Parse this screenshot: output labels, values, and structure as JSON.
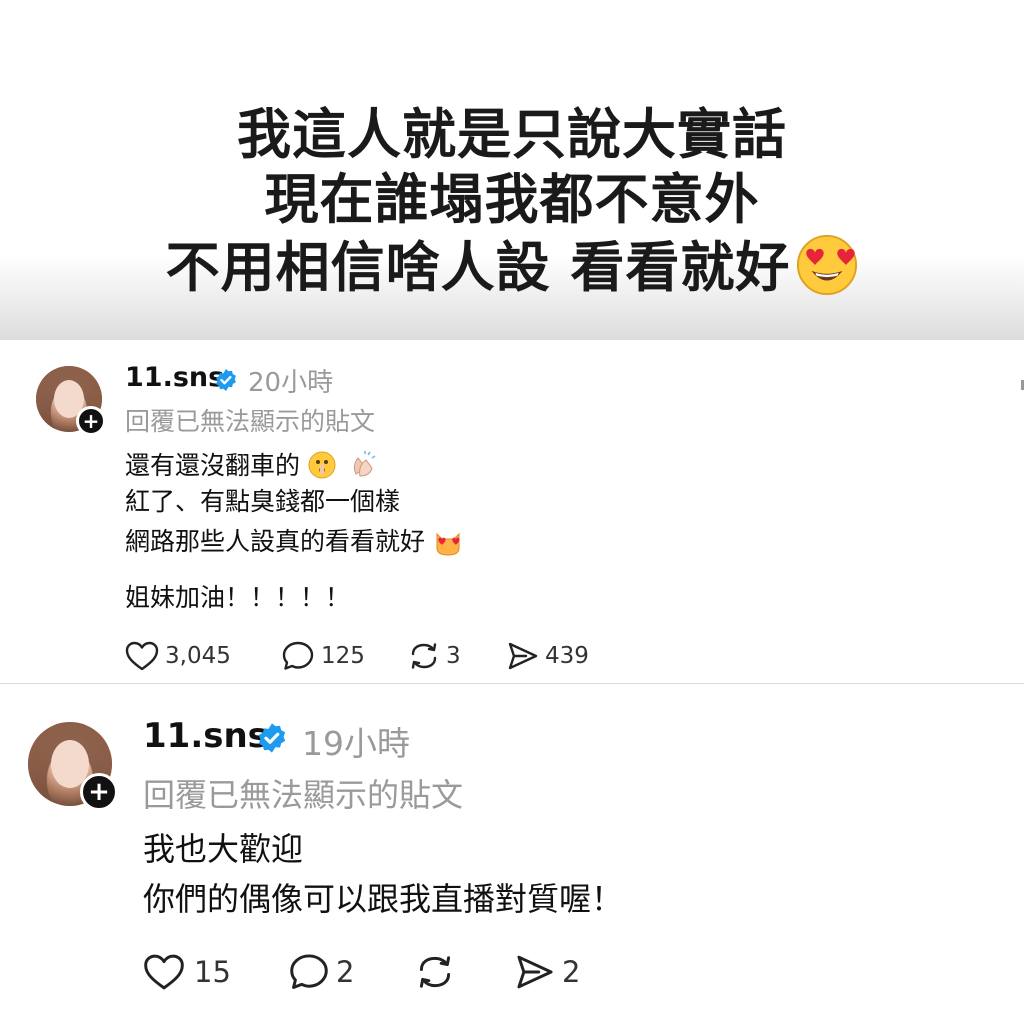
{
  "banner": {
    "lines": [
      "我這人就是只說大實話",
      "現在誰塌我都不意外",
      "不用相信啥人設 看看就好"
    ],
    "emoji": "smiling-face-with-heart-eyes"
  },
  "posts": [
    {
      "username": "11.sns",
      "time": "20小時",
      "reply_note": "回覆已無法顯示的貼文",
      "lines": [
        "還有還沒翻車的",
        "紅了、有點臭錢都一個樣",
        "網路那些人設真的看看就好",
        "姐妹加油！！！！！"
      ],
      "inline_emojis": [
        "shushing-face",
        "clapping-hands",
        "heart-eyes-cat"
      ],
      "likes": "3,045",
      "comments": "125",
      "reposts": "3",
      "shares": "439"
    },
    {
      "username": "11.sns",
      "time": "19小時",
      "reply_note": "回覆已無法顯示的貼文",
      "lines": [
        "我也大歡迎",
        "你們的偶像可以跟我直播對質喔！"
      ],
      "likes": "15",
      "comments": "2",
      "reposts": "",
      "shares": "2"
    }
  ],
  "colors": {
    "verified": "#1d9bf0",
    "muted": "#9a9a9a"
  }
}
